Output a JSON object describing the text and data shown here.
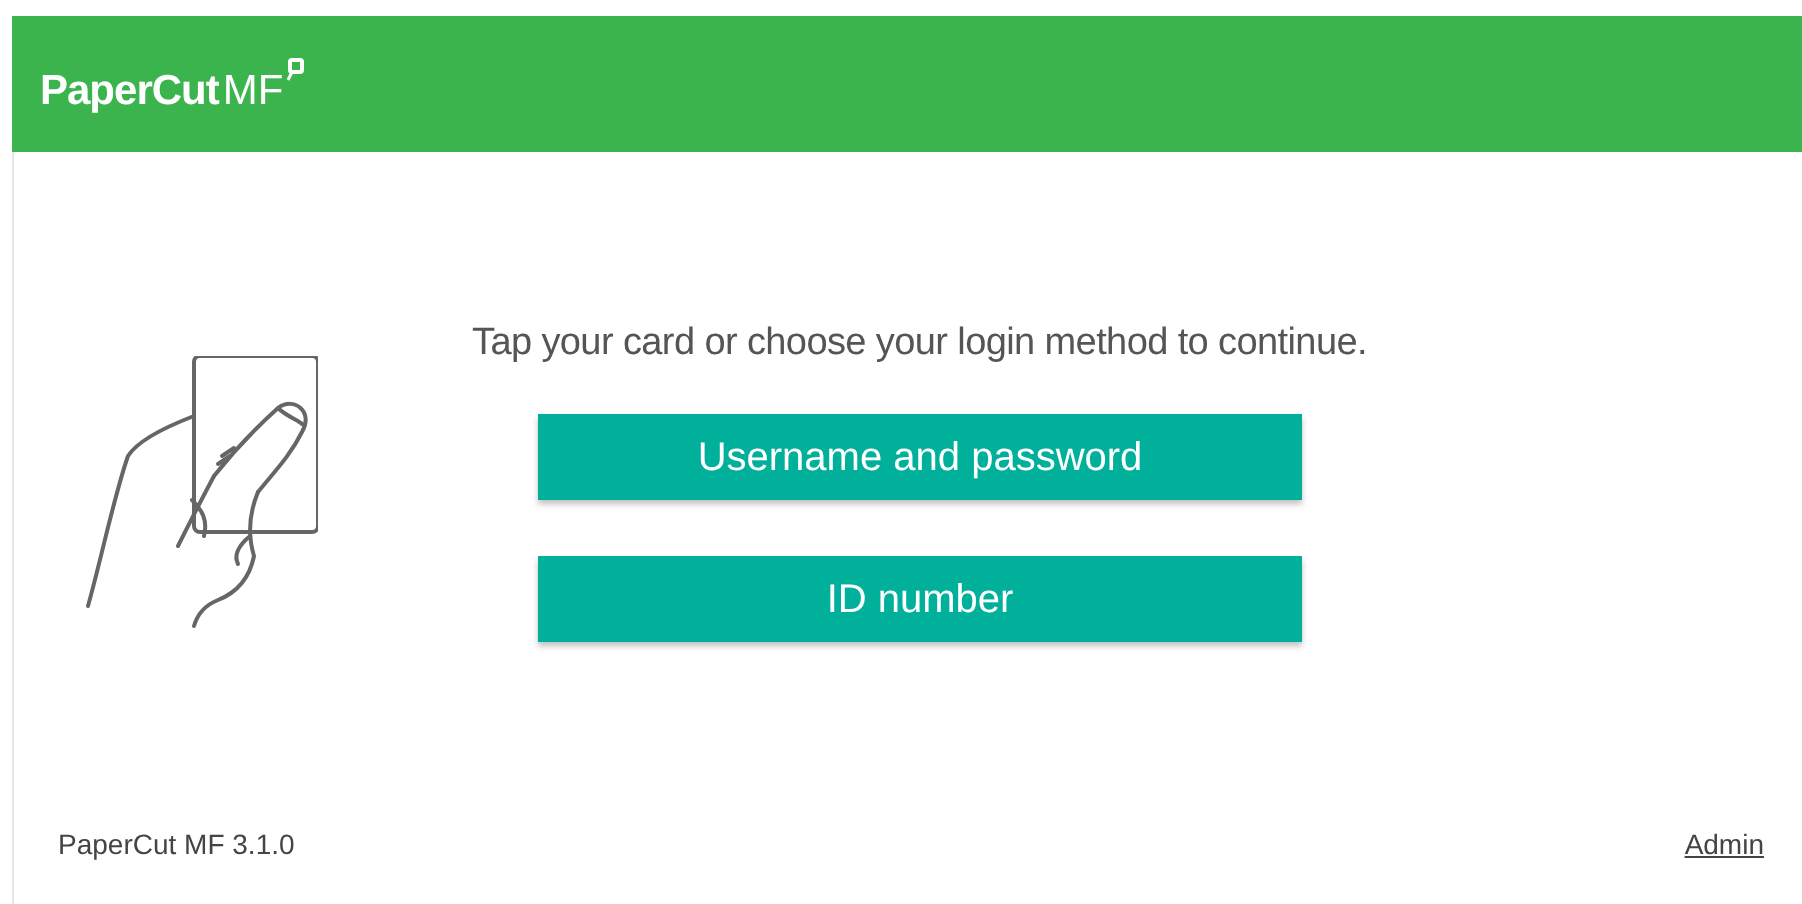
{
  "header": {
    "logo_name": "PaperCut",
    "logo_suffix": "MF"
  },
  "prompt": "Tap your card or choose your login method to continue.",
  "login_methods": [
    {
      "label": "Username and password"
    },
    {
      "label": "ID number"
    }
  ],
  "footer": {
    "version": "PaperCut MF 3.1.0",
    "admin_link": "Admin"
  }
}
